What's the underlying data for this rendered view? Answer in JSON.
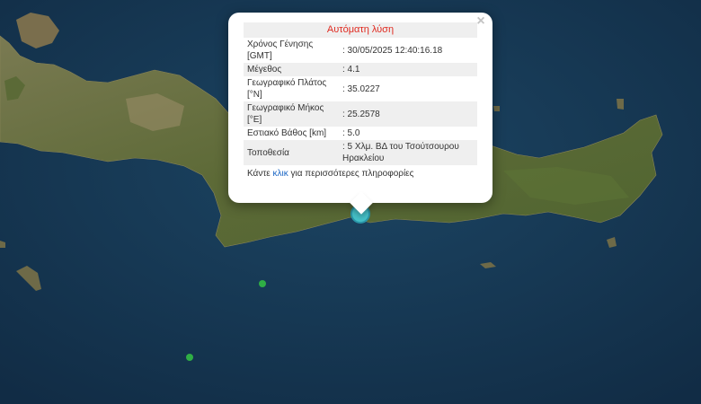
{
  "map": {
    "colors": {
      "sea": "#173a55",
      "land": "#5f6b3a",
      "highlight": "#46c1c8",
      "minor_quake": "#2fae45"
    }
  },
  "popup": {
    "header": "Αυτόματη λύση",
    "close_symbol": "×",
    "rows": [
      {
        "label": "Χρόνος Γένησης [GMT]",
        "value": ": 30/05/2025 12:40:16.18"
      },
      {
        "label": "Μέγεθος",
        "value": ": 4.1"
      },
      {
        "label": "Γεωγραφικό Πλάτος [°N]",
        "value": ": 35.0227"
      },
      {
        "label": "Γεωγραφικό Μήκος [°E]",
        "value": ": 25.2578"
      },
      {
        "label": "Εστιακό Βάθος [km]",
        "value": ": 5.0"
      },
      {
        "label": "Τοποθεσία",
        "value": ": 5 Χλμ. ΒΔ του Τσούτσουρου Ηρακλείου"
      }
    ],
    "more_before": "Κάντε ",
    "more_link": "κλικ",
    "more_after": " για περισσότερες πληροφορίες"
  }
}
